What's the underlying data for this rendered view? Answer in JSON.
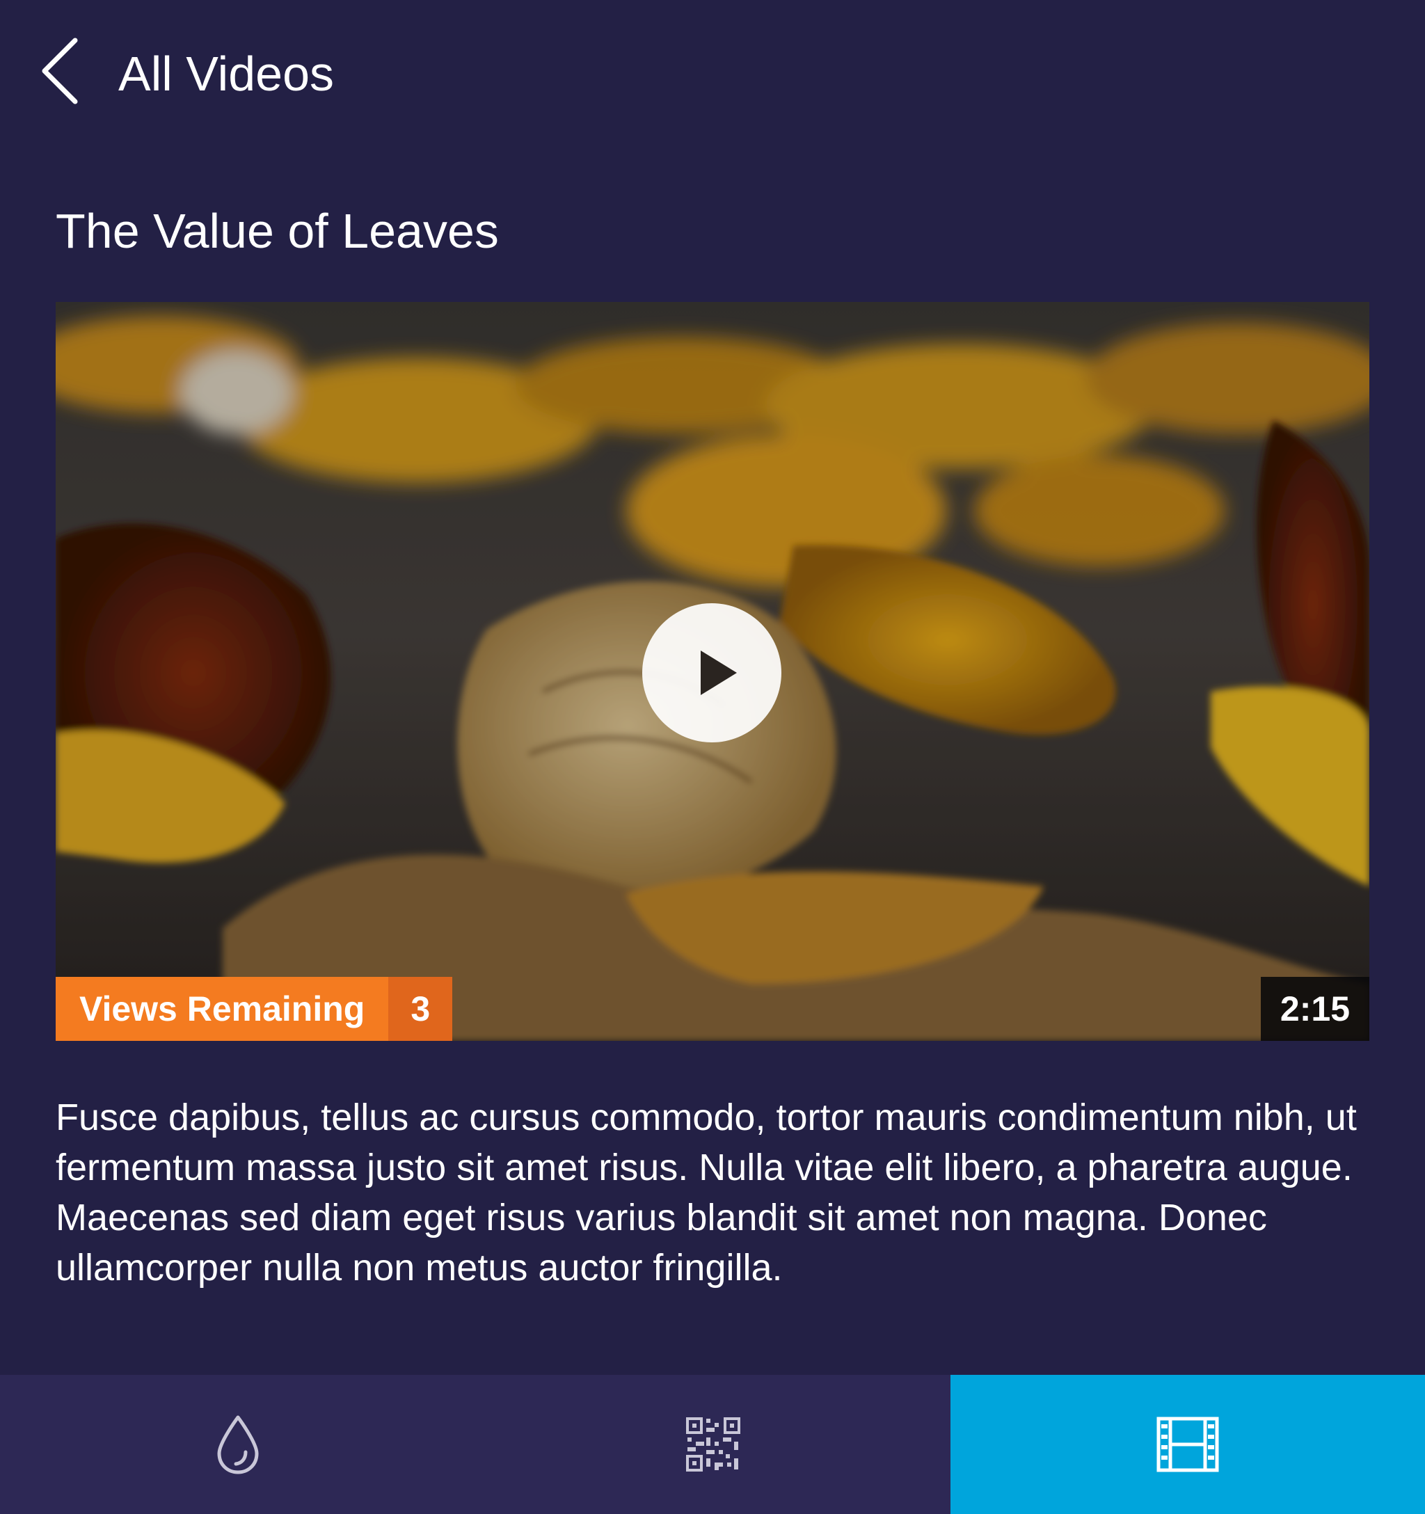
{
  "header": {
    "back_icon": "chevron-left-icon",
    "title": "All Videos"
  },
  "video": {
    "title": "The Value of Leaves",
    "thumbnail_icon": "autumn-leaves-thumbnail",
    "play_icon": "play-icon",
    "views_remaining_label": "Views Remaining",
    "views_remaining_count": "3",
    "duration": "2:15",
    "description": "Fusce dapibus, tellus ac cursus commodo, tortor mauris condimentum nibh, ut fermentum massa justo sit amet risus. Nulla vitae elit libero, a pharetra augue. Maecenas sed diam eget risus varius blandit sit amet non magna. Donec ullamcorper nulla non metus auctor fringilla."
  },
  "tabbar": {
    "tabs": [
      {
        "icon": "water-drop-icon",
        "active": false
      },
      {
        "icon": "qr-code-icon",
        "active": false
      },
      {
        "icon": "film-strip-icon",
        "active": true
      }
    ]
  },
  "colors": {
    "background": "#232045",
    "tabbar": "#2d2855",
    "active_tab": "#00a5dc",
    "views_badge": "#f47b20",
    "views_count_badge": "#e0661c"
  }
}
